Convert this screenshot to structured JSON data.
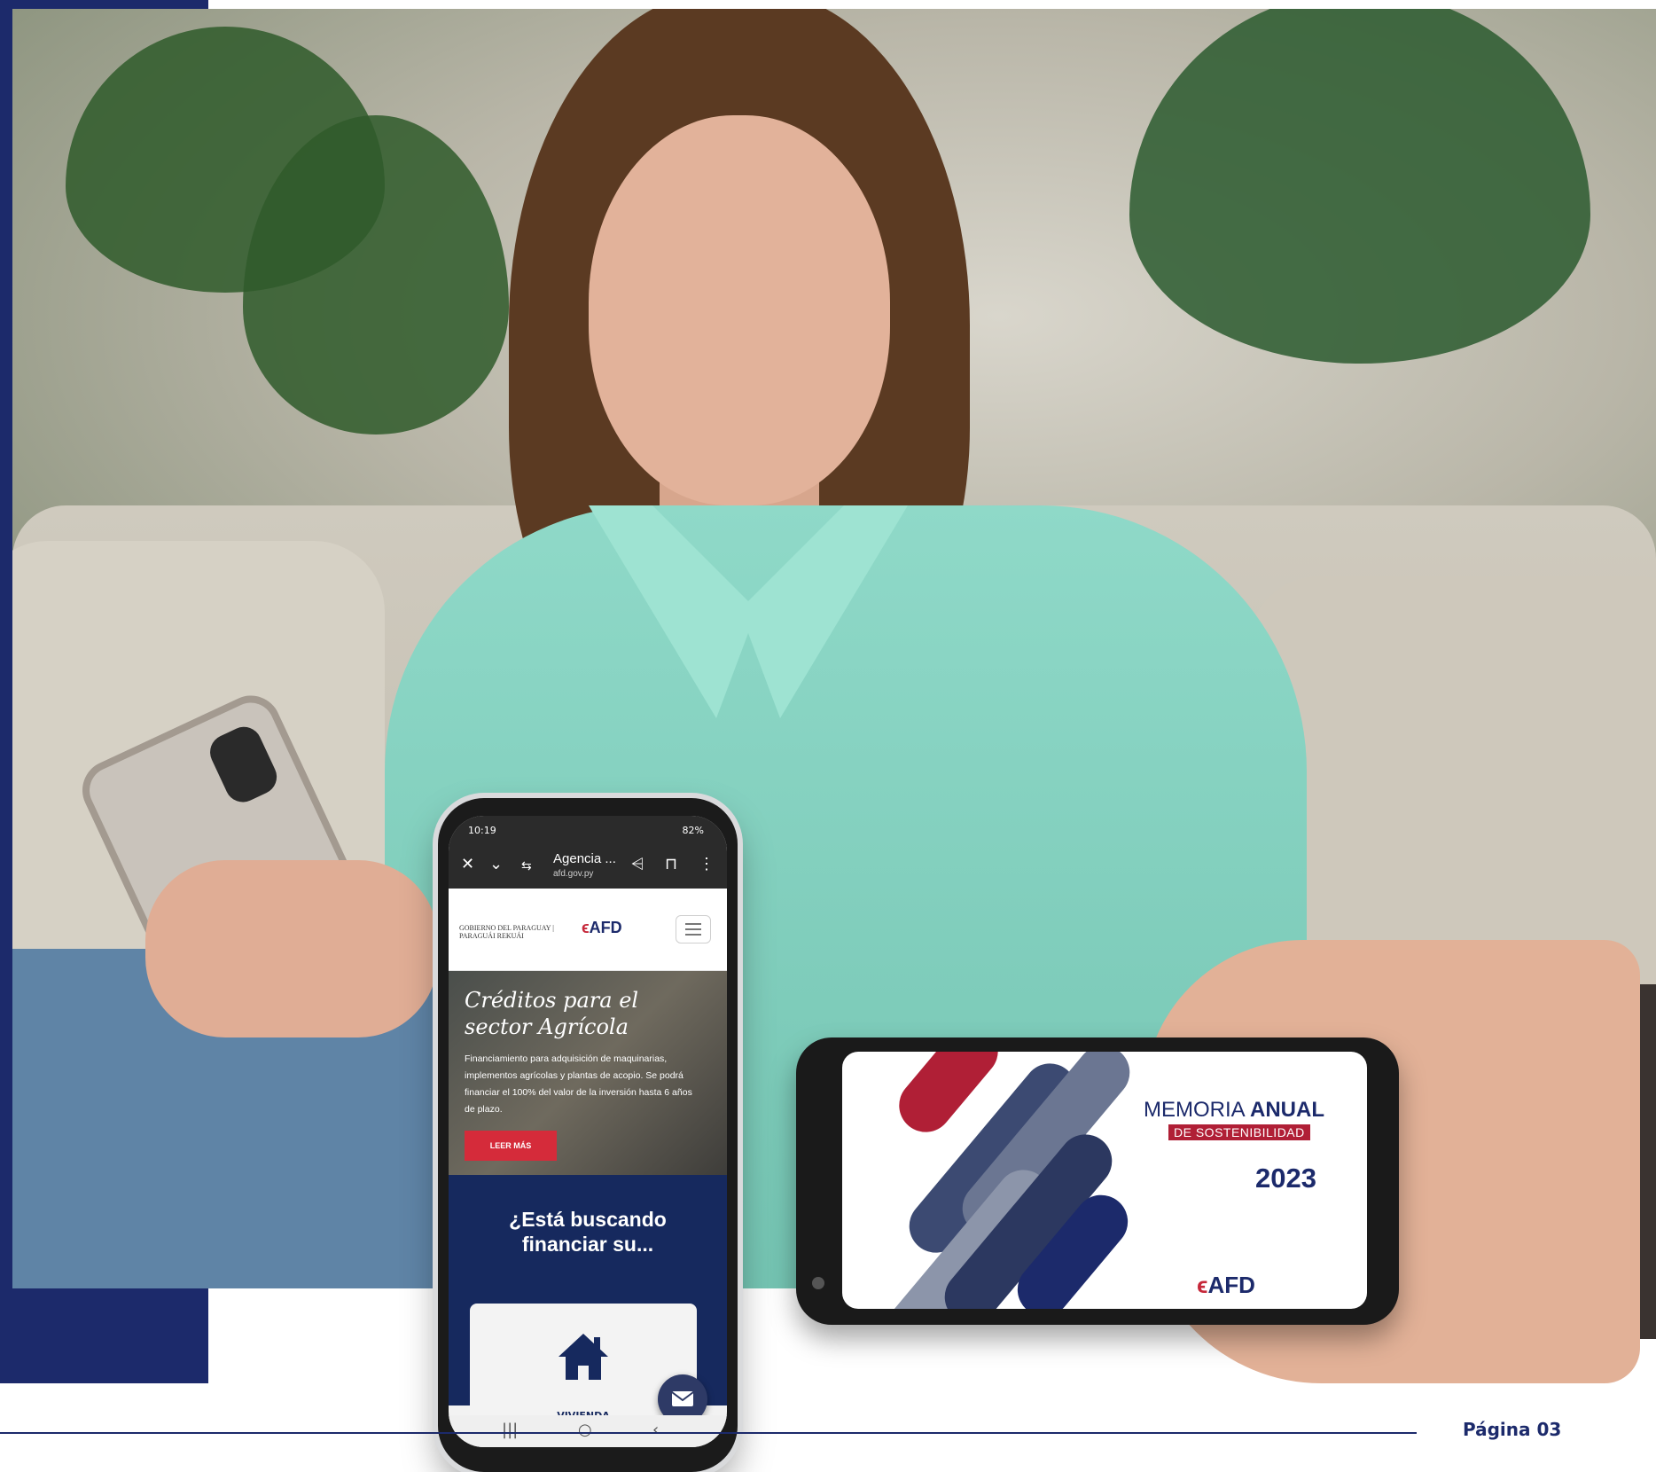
{
  "phone_left": {
    "status_time": "10:19",
    "status_battery": "82%",
    "browser_title": "Agencia ...",
    "browser_url": "afd.gov.py",
    "gov_logo_text": "GOBIERNO DEL PARAGUAY | PARAGUÁI REKUÁI",
    "afd_logo": "AFD",
    "banner_title": "Créditos para el sector Agrícola",
    "banner_text": "Financiamiento para adquisición de maquinarias, implementos agrícolas y plantas de acopio. Se podrá financiar el 100% del valor de la inversión hasta 6 años de plazo.",
    "leer_mas": "LEER MÁS",
    "cta_title": "¿Está buscando financiar su...",
    "card_label": "VIVIENDA"
  },
  "phone_right": {
    "title_prefix": "MEMORIA ",
    "title_bold": "ANUAL",
    "subtitle": "DE SOSTENIBILIDAD",
    "year": "2023",
    "afd_logo": "AFD"
  },
  "footer": {
    "page_label": "Página 03"
  },
  "colors": {
    "navy": "#1c2a6b",
    "red": "#c6283a"
  }
}
